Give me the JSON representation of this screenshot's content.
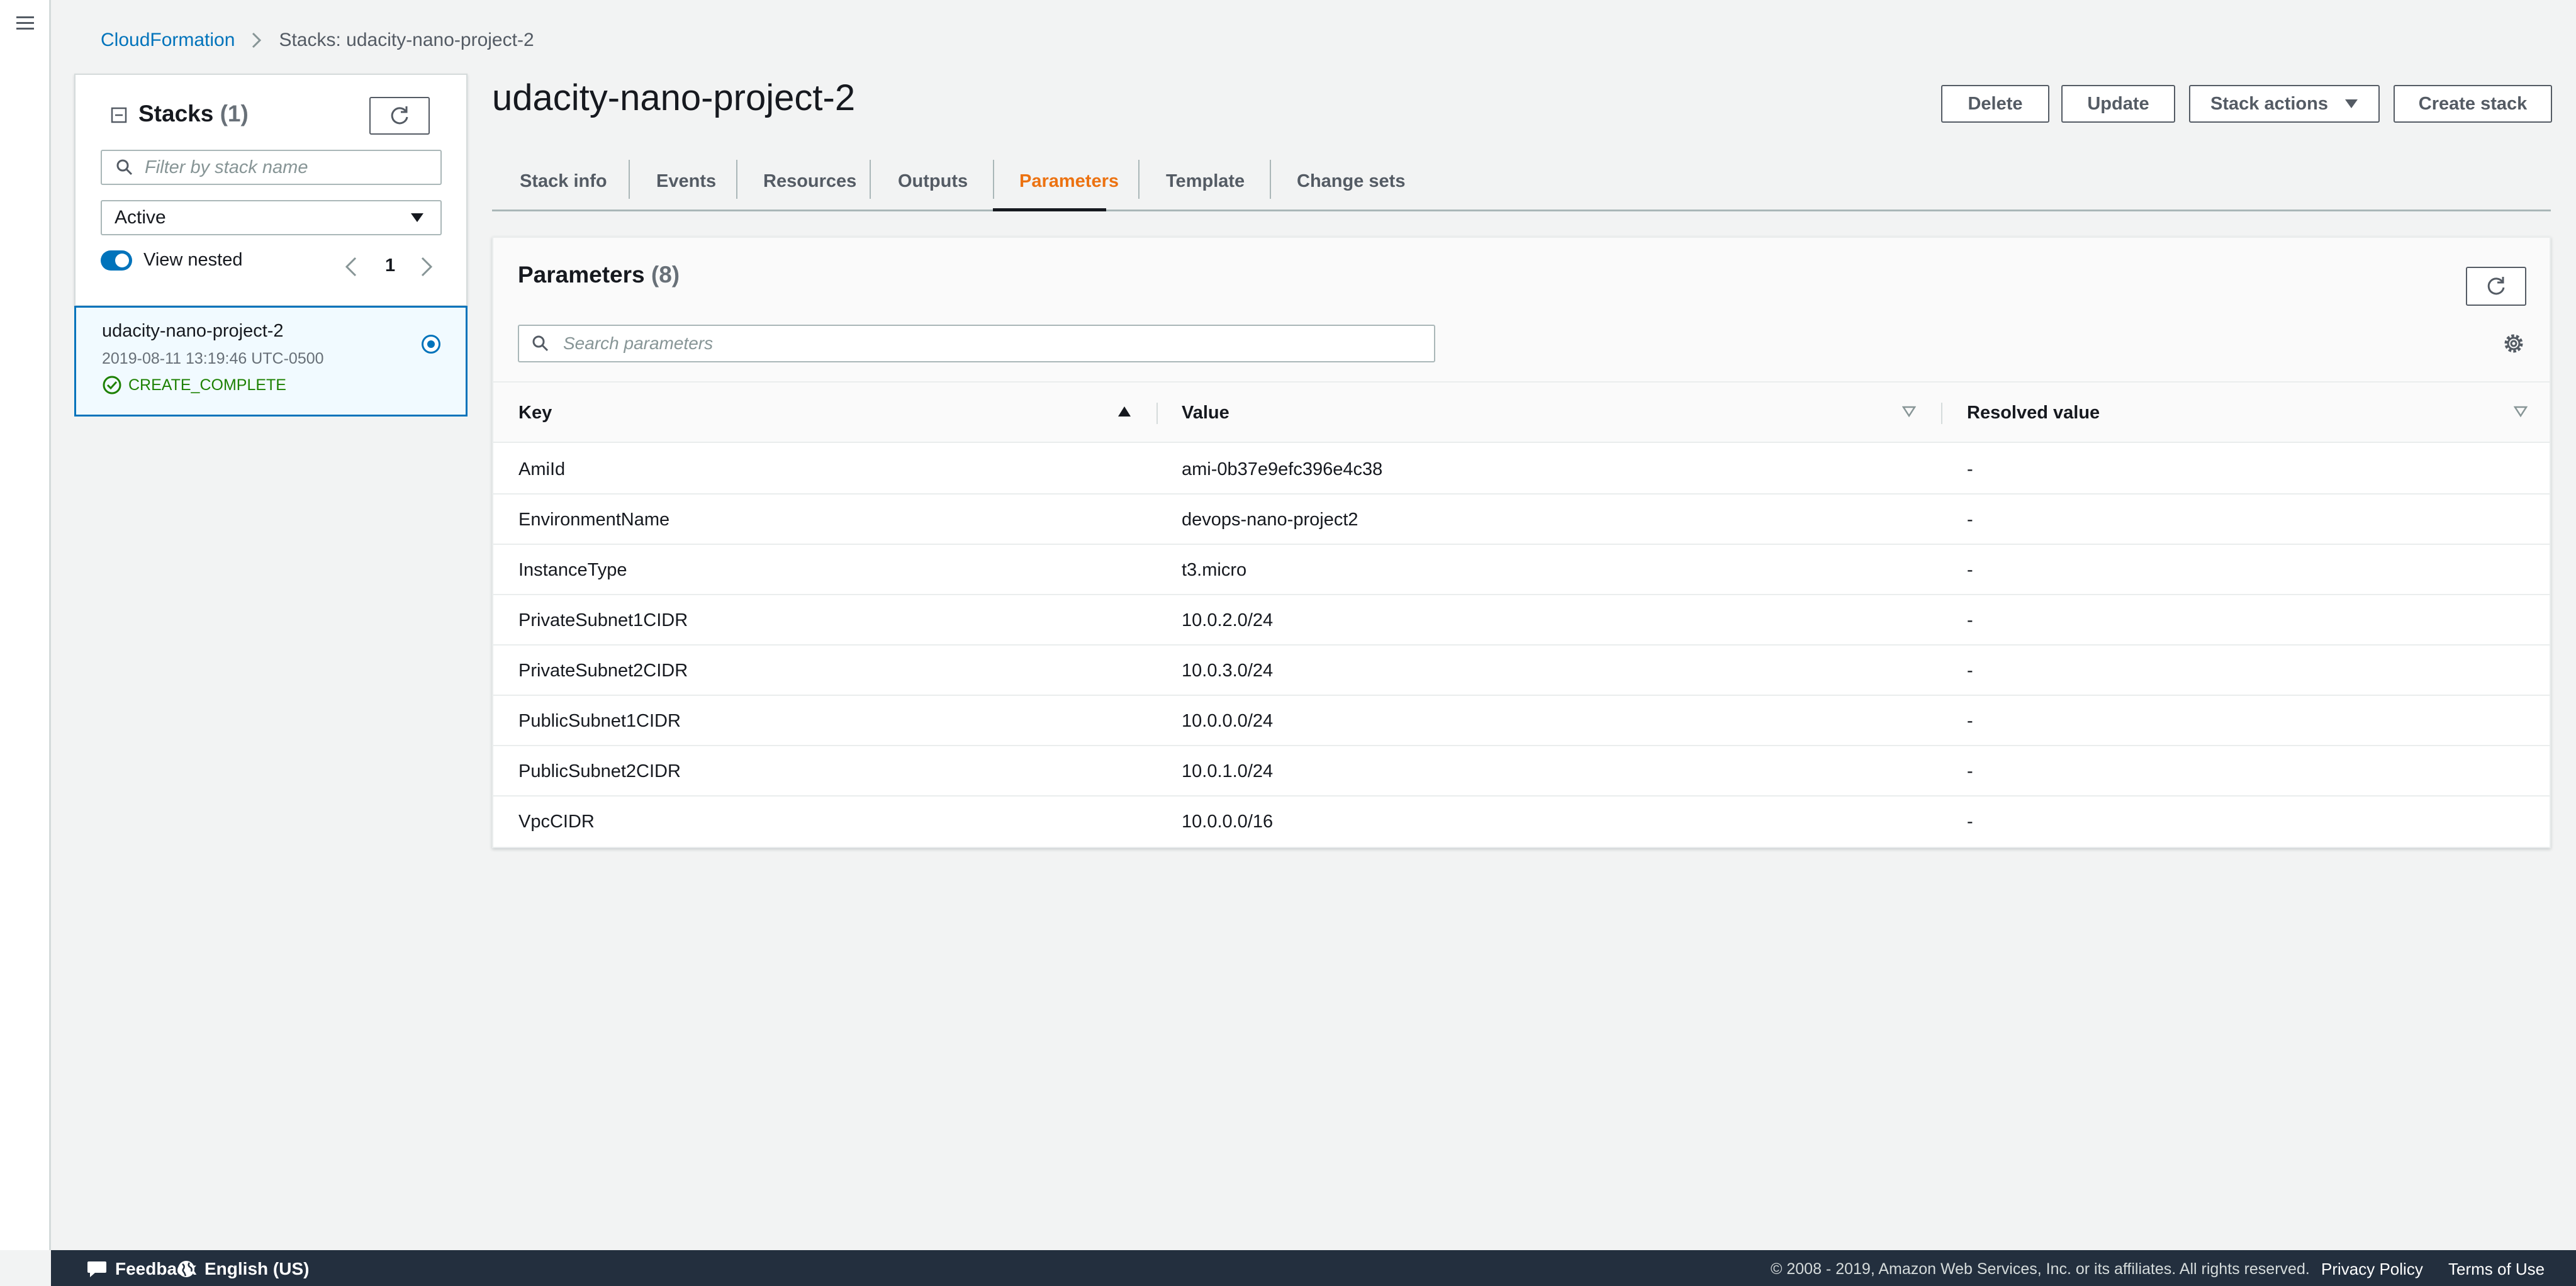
{
  "breadcrumb": {
    "root": "CloudFormation",
    "current": "Stacks: udacity-nano-project-2"
  },
  "stacks_panel": {
    "title": "Stacks",
    "count": "(1)",
    "filter_placeholder": "Filter by stack name",
    "status_filter": "Active",
    "view_nested_label": "View nested",
    "view_nested_on": true,
    "page": "1",
    "items": [
      {
        "name": "udacity-nano-project-2",
        "created": "2019-08-11 13:19:46 UTC-0500",
        "status": "CREATE_COMPLETE",
        "selected": true
      }
    ]
  },
  "header": {
    "title": "udacity-nano-project-2",
    "buttons": {
      "delete": "Delete",
      "update": "Update",
      "stack_actions": "Stack actions",
      "create": "Create stack"
    }
  },
  "tabs": [
    {
      "label": "Stack info",
      "active": false
    },
    {
      "label": "Events",
      "active": false
    },
    {
      "label": "Resources",
      "active": false
    },
    {
      "label": "Outputs",
      "active": false
    },
    {
      "label": "Parameters",
      "active": true
    },
    {
      "label": "Template",
      "active": false
    },
    {
      "label": "Change sets",
      "active": false
    }
  ],
  "parameters": {
    "title": "Parameters",
    "count": "(8)",
    "search_placeholder": "Search parameters",
    "columns": [
      "Key",
      "Value",
      "Resolved value"
    ],
    "rows": [
      {
        "key": "AmiId",
        "value": "ami-0b37e9efc396e4c38",
        "resolved": "-"
      },
      {
        "key": "EnvironmentName",
        "value": "devops-nano-project2",
        "resolved": "-"
      },
      {
        "key": "InstanceType",
        "value": "t3.micro",
        "resolved": "-"
      },
      {
        "key": "PrivateSubnet1CIDR",
        "value": "10.0.2.0/24",
        "resolved": "-"
      },
      {
        "key": "PrivateSubnet2CIDR",
        "value": "10.0.3.0/24",
        "resolved": "-"
      },
      {
        "key": "PublicSubnet1CIDR",
        "value": "10.0.0.0/24",
        "resolved": "-"
      },
      {
        "key": "PublicSubnet2CIDR",
        "value": "10.0.1.0/24",
        "resolved": "-"
      },
      {
        "key": "VpcCIDR",
        "value": "10.0.0.0/16",
        "resolved": "-"
      }
    ]
  },
  "footer": {
    "feedback": "Feedback",
    "language": "English (US)",
    "copyright": "© 2008 - 2019, Amazon Web Services, Inc. or its affiliates. All rights reserved.",
    "privacy": "Privacy Policy",
    "terms": "Terms of Use"
  },
  "icons": {
    "menu": "hamburger-menu-icon",
    "refresh": "refresh-icon",
    "search": "search-icon",
    "settings": "gear-icon",
    "status_ok": "check-circle-icon",
    "feedback": "speech-bubble-icon",
    "language": "globe-icon"
  },
  "colors": {
    "link": "#0073bb",
    "active_tab": "#ec7211",
    "success": "#1d8102",
    "footer_bg": "#232f3e"
  }
}
